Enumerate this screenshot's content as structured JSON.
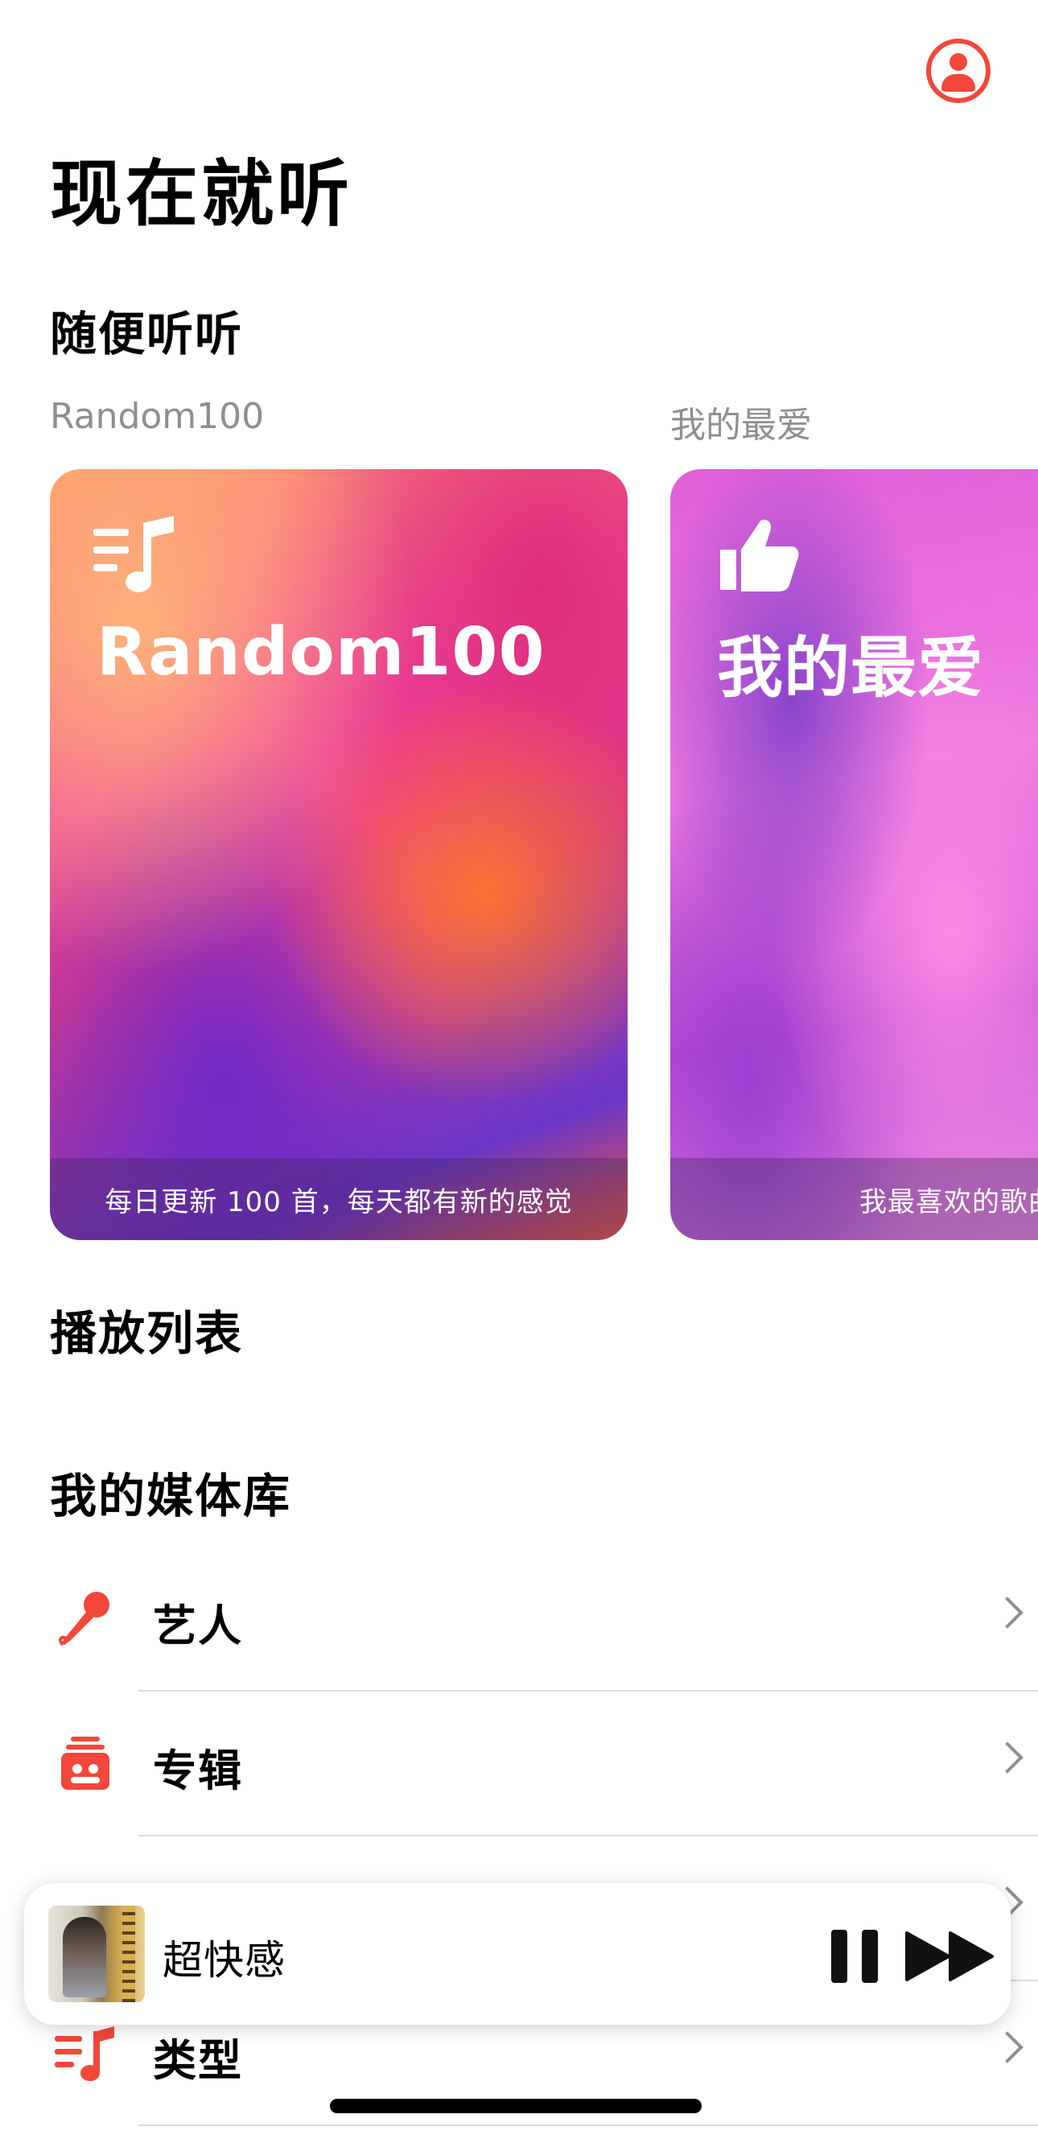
{
  "header": {
    "title": "现在就听",
    "profile_icon": "person-circle-icon"
  },
  "sections": {
    "random_title": "随便听听",
    "playlists_title": "播放列表",
    "library_title": "我的媒体库"
  },
  "cards": [
    {
      "caption": "Random100",
      "label": "Random100",
      "icon": "music-list-icon",
      "description": "每日更新 100 首，每天都有新的感觉"
    },
    {
      "caption": "我的最爱",
      "label": "我的最爱",
      "icon": "thumbs-up-icon",
      "description": "我最喜欢的歌曲"
    }
  ],
  "library": {
    "items": [
      {
        "label": "艺人",
        "icon": "microphone-icon"
      },
      {
        "label": "专辑",
        "icon": "album-stack-icon"
      },
      {
        "label": "类型",
        "icon": "genre-list-icon"
      }
    ]
  },
  "player": {
    "track_title": "超快感",
    "pause_icon": "pause-icon",
    "next_icon": "fast-forward-icon"
  },
  "colors": {
    "accent": "#f2473a",
    "secondary_text": "#8e8e93"
  }
}
